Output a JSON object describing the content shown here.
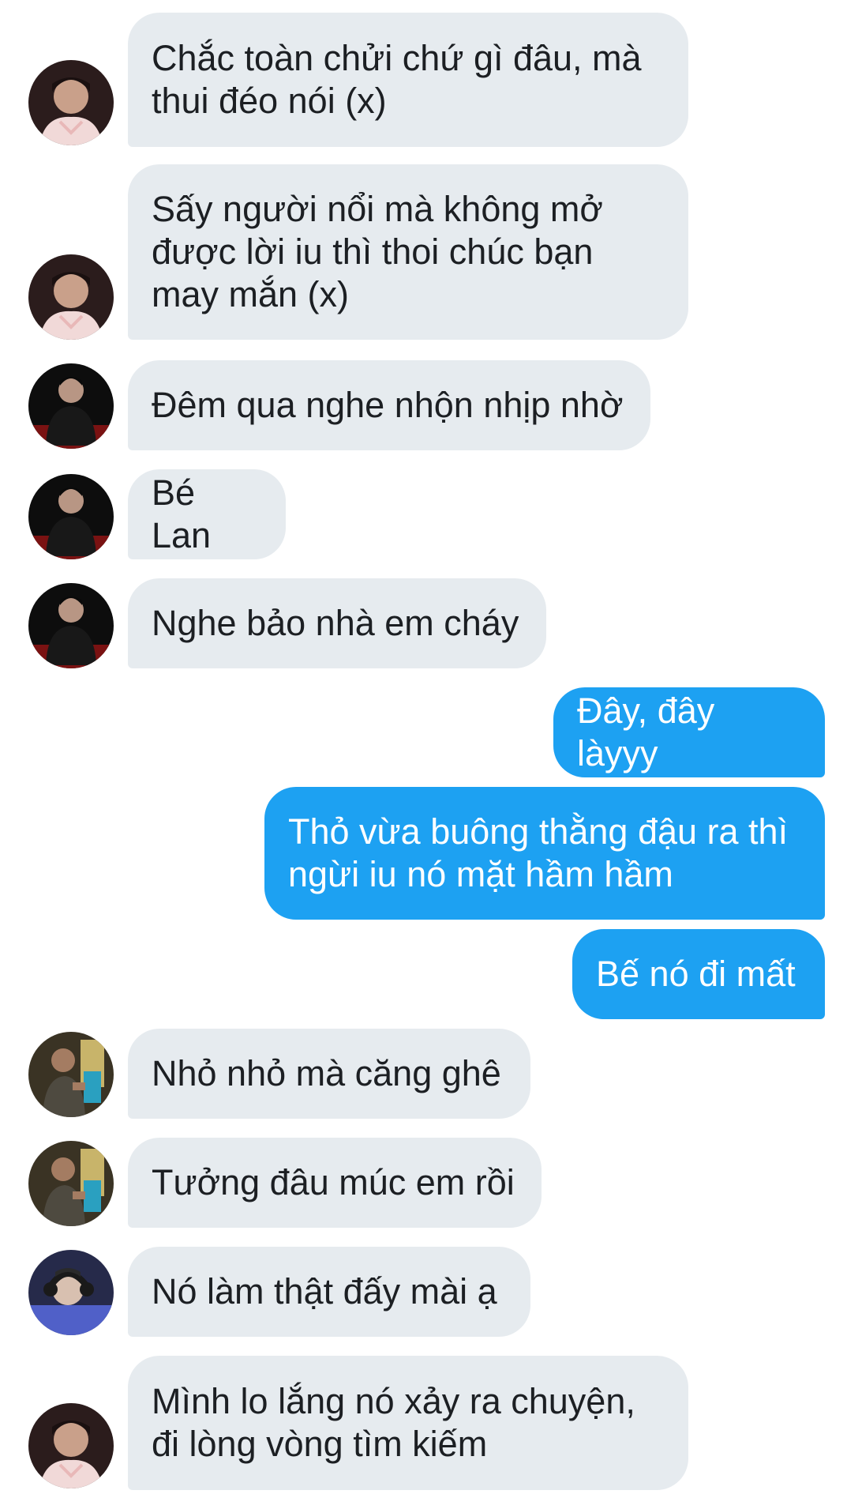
{
  "conversation": {
    "colors": {
      "incoming_bubble": "#e6ebef",
      "outgoing_bubble": "#1da1f2",
      "incoming_text": "#1c1f23",
      "outgoing_text": "#ffffff",
      "background": "#ffffff"
    },
    "messages": [
      {
        "direction": "incoming",
        "sender_avatar": "avatar-pink-jacket",
        "text": "Chắc toàn chửi chứ gì đâu, mà thui đéo nói (x)"
      },
      {
        "direction": "incoming",
        "sender_avatar": "avatar-pink-jacket",
        "text": "Sấy người nổi mà không mở được lời iu thì thoi chúc bạn may mắn (x)"
      },
      {
        "direction": "incoming",
        "sender_avatar": "avatar-black-outfit",
        "text": "Đêm qua nghe nhộn nhịp nhờ"
      },
      {
        "direction": "incoming",
        "sender_avatar": "avatar-black-outfit",
        "text": "Bé Lan"
      },
      {
        "direction": "incoming",
        "sender_avatar": "avatar-black-outfit",
        "text": "Nghe bảo nhà em cháy"
      },
      {
        "direction": "outgoing",
        "text": "Đây, đây làyyy"
      },
      {
        "direction": "outgoing",
        "text": "Thỏ vừa buông thằng đậu ra thì ngừi iu nó mặt hầm hầm"
      },
      {
        "direction": "outgoing",
        "text": "Bế nó đi mất"
      },
      {
        "direction": "incoming",
        "sender_avatar": "avatar-gym",
        "text": "Nhỏ nhỏ mà căng ghê"
      },
      {
        "direction": "incoming",
        "sender_avatar": "avatar-gym",
        "text": "Tưởng đâu múc em rồi"
      },
      {
        "direction": "incoming",
        "sender_avatar": "avatar-headphones",
        "text": "Nó làm thật đấy mài ạ"
      },
      {
        "direction": "incoming",
        "sender_avatar": "avatar-pink-jacket",
        "text": "Mình lo lắng nó xảy ra chuyện, đi lòng vòng tìm kiếm"
      }
    ]
  }
}
